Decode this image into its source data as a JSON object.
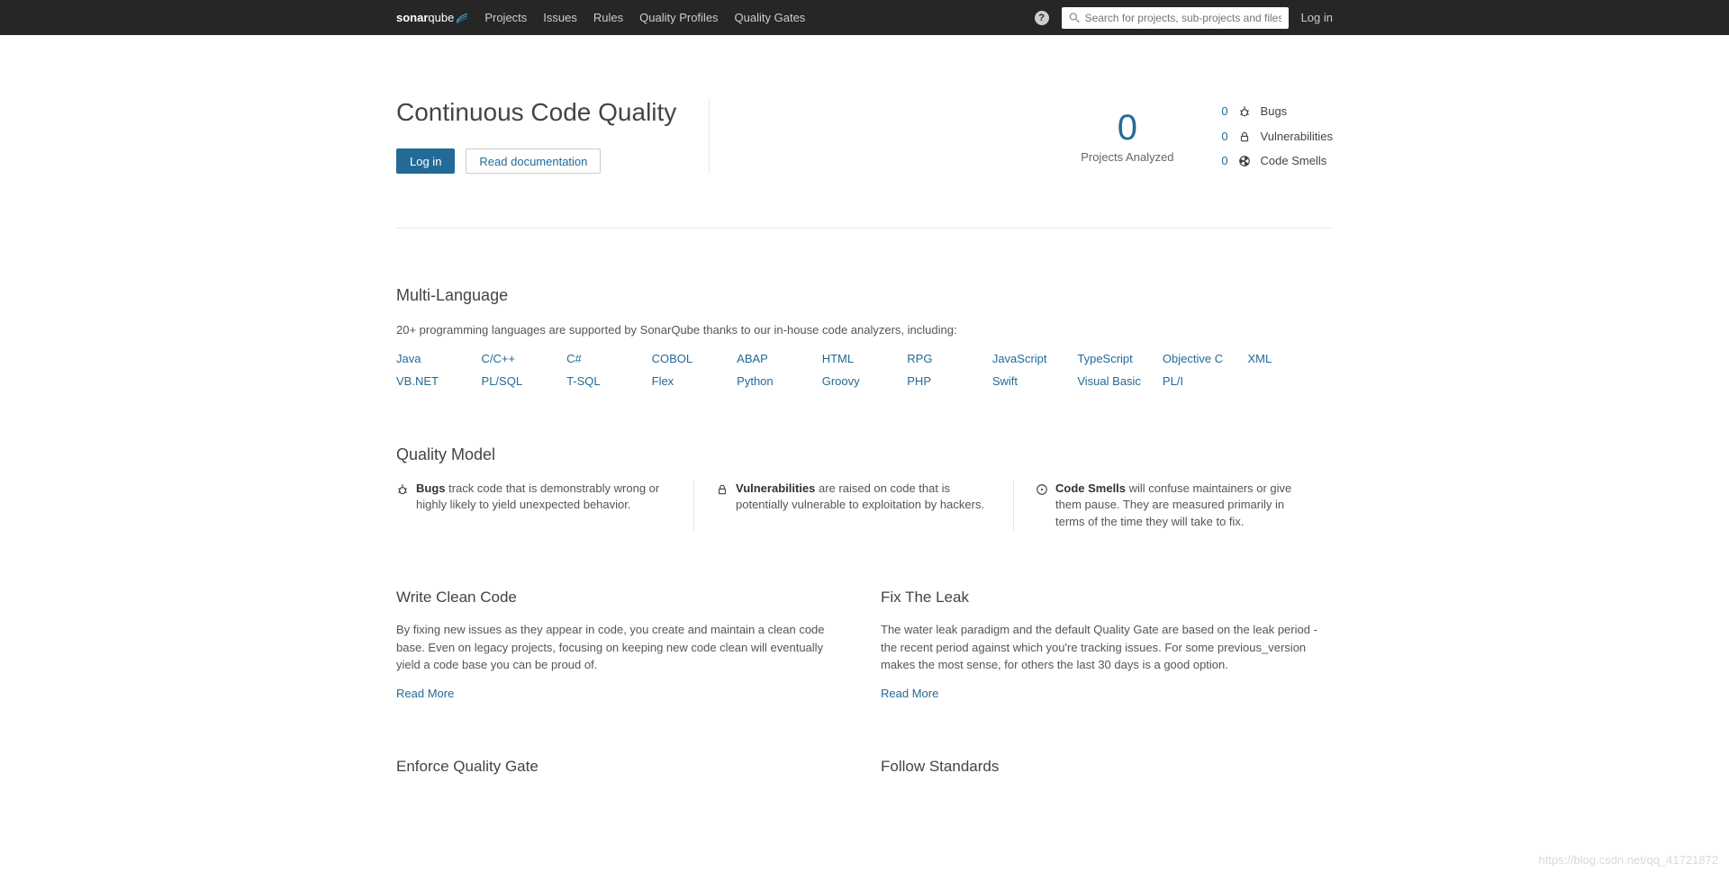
{
  "nav": {
    "logo_left": "sonar",
    "logo_right": "qube",
    "items": [
      "Projects",
      "Issues",
      "Rules",
      "Quality Profiles",
      "Quality Gates"
    ],
    "search_placeholder": "Search for projects, sub-projects and files...",
    "login": "Log in"
  },
  "hero": {
    "title": "Continuous Code Quality",
    "login_btn": "Log in",
    "docs_btn": "Read documentation",
    "projects_count": "0",
    "projects_label": "Projects Analyzed",
    "metrics": [
      {
        "count": "0",
        "name": "Bugs"
      },
      {
        "count": "0",
        "name": "Vulnerabilities"
      },
      {
        "count": "0",
        "name": "Code Smells"
      }
    ]
  },
  "multilang": {
    "heading": "Multi-Language",
    "intro": "20+ programming languages are supported by SonarQube thanks to our in-house code analyzers, including:",
    "row1": [
      "Java",
      "C/C++",
      "C#",
      "COBOL",
      "ABAP",
      "HTML",
      "RPG",
      "JavaScript",
      "TypeScript",
      "Objective C",
      "XML"
    ],
    "row2": [
      "VB.NET",
      "PL/SQL",
      "T-SQL",
      "Flex",
      "Python",
      "Groovy",
      "PHP",
      "Swift",
      "Visual Basic",
      "PL/I"
    ]
  },
  "quality_model": {
    "heading": "Quality Model",
    "items": [
      {
        "bold": "Bugs",
        "text": " track code that is demonstrably wrong or highly likely to yield unexpected behavior."
      },
      {
        "bold": "Vulnerabilities",
        "text": " are raised on code that is potentially vulnerable to exploitation by hackers."
      },
      {
        "bold": "Code Smells",
        "text": " will confuse maintainers or give them pause. They are measured primarily in terms of the time they will take to fix."
      }
    ]
  },
  "clean_code": {
    "heading": "Write Clean Code",
    "body": "By fixing new issues as they appear in code, you create and maintain a clean code base. Even on legacy projects, focusing on keeping new code clean will eventually yield a code base you can be proud of.",
    "read_more": "Read More"
  },
  "fix_leak": {
    "heading": "Fix The Leak",
    "body": "The water leak paradigm and the default Quality Gate are based on the leak period - the recent period against which you're tracking issues. For some previous_version makes the most sense, for others the last 30 days is a good option.",
    "read_more": "Read More"
  },
  "enforce_qg": {
    "heading": "Enforce Quality Gate"
  },
  "follow_std": {
    "heading": "Follow Standards"
  },
  "watermark": "https://blog.csdn.net/qq_41721872"
}
